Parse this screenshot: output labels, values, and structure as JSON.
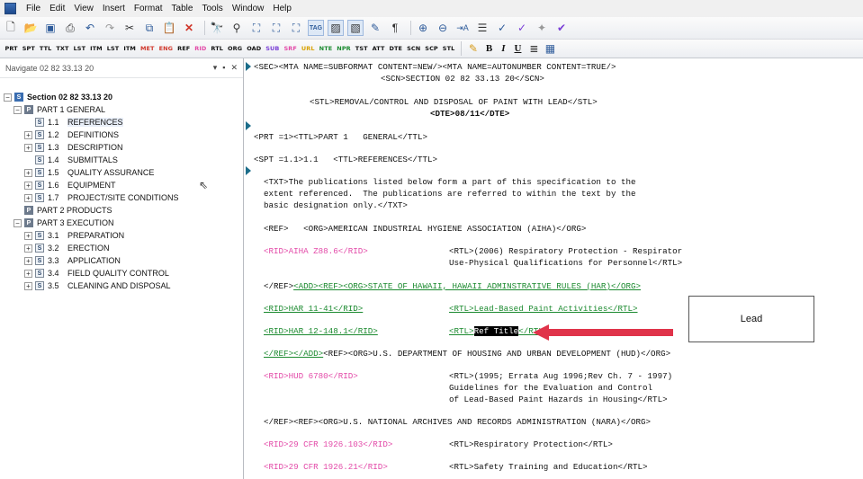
{
  "menubar": {
    "items": [
      "File",
      "Edit",
      "View",
      "Insert",
      "Format",
      "Table",
      "Tools",
      "Window",
      "Help"
    ]
  },
  "toolbar1": {
    "icons": [
      "new-doc-icon",
      "open-folder-icon",
      "save-icon",
      "print-icon",
      "undo-icon",
      "redo-icon",
      "cut-icon",
      "copy-icon",
      "paste-icon",
      "delete-icon",
      "find-icon",
      "find-replace-icon",
      "tag-a-icon",
      "tag-b-icon",
      "tag-c-icon",
      "show-tags-icon",
      "tag-view-icon",
      "edit-view-icon",
      "spell-icon",
      "paragraph-icon",
      "zoom-in-icon",
      "zoom-out-icon",
      "insert-icon",
      "list-icon",
      "spell-check-icon",
      "validate-icon",
      "star-icon",
      "check-icon"
    ]
  },
  "toolbar2": {
    "tags": [
      "PRT",
      "SPT",
      "TTL",
      "TXT",
      "LST",
      "ITM",
      "LST",
      "ITM",
      "MET",
      "ENG",
      "REF",
      "RID",
      "RTL",
      "ORG",
      "OAD",
      "SUB",
      "SRF",
      "URL",
      "NTE",
      "NPR",
      "TST",
      "ATT",
      "DTE",
      "SCN",
      "SCP",
      "STL"
    ],
    "tag_colors": {
      "MET": "#d0362a",
      "ENG": "#d0362a",
      "RID": "#e34aa8",
      "SUB": "#7a3fd6",
      "SRF": "#e34aa8",
      "URL": "#d9a200",
      "NTE": "#1b8a2f",
      "NPR": "#1b8a2f"
    },
    "format": {
      "bold": "B",
      "italic": "I",
      "underline": "U"
    }
  },
  "nav": {
    "title": "Navigate 02 82 33.13 20",
    "controls": [
      "▾",
      "▪",
      "✕"
    ],
    "section": {
      "label": "Section 02 82 33.13 20"
    },
    "parts": [
      {
        "label": "PART 1  GENERAL",
        "items": [
          {
            "num": "1.1",
            "label": "REFERENCES"
          },
          {
            "num": "1.2",
            "label": "DEFINITIONS"
          },
          {
            "num": "1.3",
            "label": "DESCRIPTION"
          },
          {
            "num": "1.4",
            "label": "SUBMITTALS"
          },
          {
            "num": "1.5",
            "label": "QUALITY ASSURANCE"
          },
          {
            "num": "1.6",
            "label": "EQUIPMENT"
          },
          {
            "num": "1.7",
            "label": "PROJECT/SITE CONDITIONS"
          }
        ]
      },
      {
        "label": "PART 2  PRODUCTS",
        "items": []
      },
      {
        "label": "PART 3  EXECUTION",
        "items": [
          {
            "num": "3.1",
            "label": "PREPARATION"
          },
          {
            "num": "3.2",
            "label": "ERECTION"
          },
          {
            "num": "3.3",
            "label": "APPLICATION"
          },
          {
            "num": "3.4",
            "label": "FIELD QUALITY CONTROL"
          },
          {
            "num": "3.5",
            "label": "CLEANING AND DISPOSAL"
          }
        ]
      }
    ]
  },
  "editor": {
    "sec_line": "<SEC><MTA NAME=SUBFORMAT CONTENT=NEW/><MTA NAME=AUTONUMBER CONTENT=TRUE/>",
    "scn_line": "<SCN>SECTION 02 82 33.13 20</SCN>",
    "stl_line": "<STL>REMOVAL/CONTROL AND DISPOSAL OF PAINT WITH LEAD</STL>",
    "dte_line": "<DTE>08/11</DTE>",
    "prt_line": "<PRT =1><TTL>PART 1   GENERAL</TTL>",
    "spt_line": "<SPT =1.1>1.1   <TTL>REFERENCES</TTL>",
    "txt_lines": [
      "<TXT>The publications listed below form a part of this specification to the",
      "extent referenced.  The publications are referred to within the text by the",
      "basic designation only.</TXT>"
    ],
    "ref1_line": "<REF>   <ORG>AMERICAN INDUSTRIAL HYGIENE ASSOCIATION (AIHA)</ORG>",
    "rid1": "<RID>AIHA Z88.6</RID>",
    "rtl1": [
      "<RTL>(2006) Respiratory Protection - Respirator",
      "Use-Physical Qualifications for Personnel</RTL>"
    ],
    "ref_end_add": "</REF>",
    "add_line": "<ADD><REF><ORG>STATE OF HAWAII, HAWAII ADMINSTRATIVE RULES (HAR)</ORG>",
    "rid2": "<RID>HAR 11-41</RID>",
    "rtl2": "<RTL>Lead-Based Paint Activities</RTL>",
    "rid3": "<RID>HAR 12-148.1</RID>",
    "rtl3_open": "<RTL>",
    "rtl3_sel": "Ref Title",
    "rtl3_close": "</RTL>",
    "add_end": "</REF></ADD>",
    "hud_line": "<REF><ORG>U.S. DEPARTMENT OF HOUSING AND URBAN DEVELOPMENT (HUD)</ORG>",
    "rid4": "<RID>HUD 6780</RID>",
    "rtl4": [
      "<RTL>(1995; Errata Aug 1996;Rev Ch. 7 - 1997)",
      "Guidelines for the Evaluation and Control",
      "of Lead-Based Paint Hazards in Housing</RTL>"
    ],
    "nara_line": "</REF><REF><ORG>U.S. NATIONAL ARCHIVES AND RECORDS ADMINISTRATION (NARA)</ORG>",
    "rid5": "<RID>29 CFR 1926.103</RID>",
    "rtl5": "<RTL>Respiratory Protection</RTL>",
    "rid6": "<RID>29 CFR 1926.21</RID>",
    "rtl6": "<RTL>Safety Training and Education</RTL>"
  },
  "annotation": {
    "label": "Lead",
    "arrow_color": "#e0334a"
  }
}
